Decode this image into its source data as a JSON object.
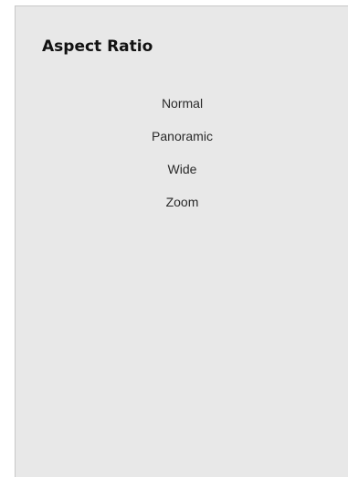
{
  "dialog": {
    "title": "Aspect Ratio",
    "options": [
      {
        "label": "Normal"
      },
      {
        "label": "Panoramic"
      },
      {
        "label": "Wide"
      },
      {
        "label": "Zoom"
      }
    ]
  },
  "colors": {
    "panel_background": "#e8e8e8",
    "text": "#2a2a2a",
    "title_text": "#111111"
  }
}
